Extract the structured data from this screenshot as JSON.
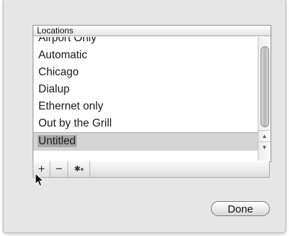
{
  "list": {
    "header": "Locations",
    "items": [
      "Airport Only",
      "Automatic",
      "Chicago",
      "Dialup",
      "Ethernet only",
      "Out by the Grill"
    ],
    "editing_item": "Untitled"
  },
  "toolbar": {
    "add_label": "+",
    "remove_label": "−",
    "action_glyph": "✱",
    "action_caret": "▾"
  },
  "scrollbar": {
    "up_arrow": "▲",
    "down_arrow": "▼"
  },
  "buttons": {
    "done_label": "Done"
  }
}
